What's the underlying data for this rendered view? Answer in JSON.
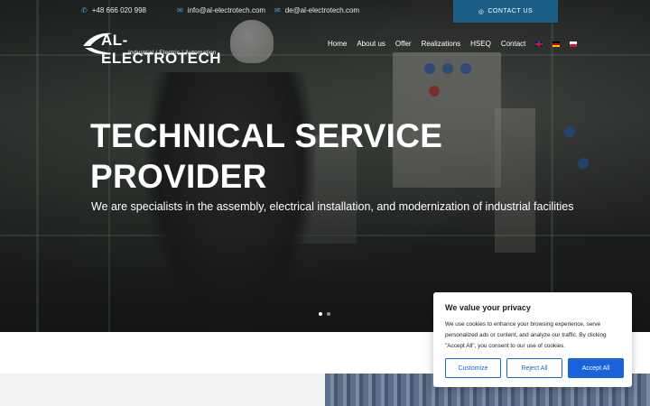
{
  "topbar": {
    "phone": "+48 666 020 998",
    "email_info": "info@al-electrotech.com",
    "email_de": "de@al-electrotech.com",
    "contact_button": "CONTACT US"
  },
  "logo": {
    "name": "AL-ELECTROTECH",
    "tagline": "Industrial | Electric | Automation"
  },
  "nav": {
    "items": [
      "Home",
      "About us",
      "Offer",
      "Realizations",
      "HSEQ",
      "Contact"
    ],
    "languages": [
      "en-flag-icon",
      "de-flag-icon",
      "pl-flag-icon"
    ]
  },
  "hero": {
    "title_line1": "TECHNICAL SERVICE",
    "title_line2": "PROVIDER",
    "subtitle": "We are specialists in the assembly, electrical installation, and modernization of industrial facilities",
    "slides": 2,
    "active_slide": 1
  },
  "cookie": {
    "title": "We value your privacy",
    "text": "We use cookies to enhance your browsing experience, serve personalized ads or content, and analyze our traffic. By clicking \"Accept All\", you consent to our use of cookies.",
    "customize": "Customize",
    "reject": "Reject All",
    "accept": "Accept All"
  },
  "colors": {
    "accent": "#1c5f86",
    "icon_blue": "#4aa3d8",
    "cookie_button": "#1863dc"
  }
}
